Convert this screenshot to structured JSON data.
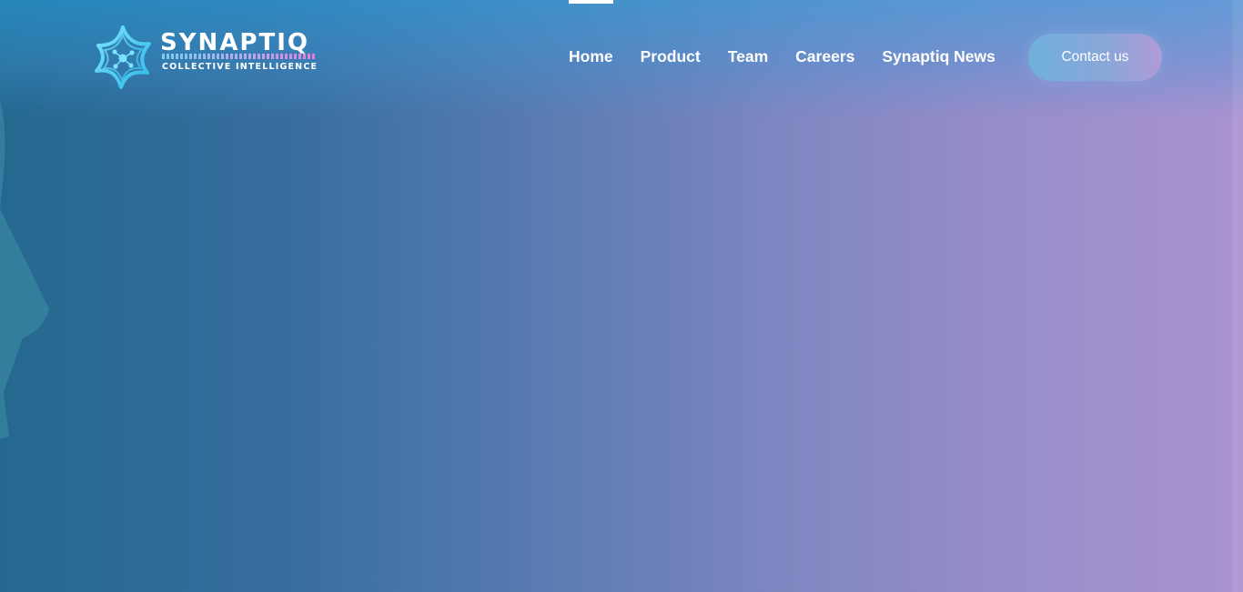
{
  "logo": {
    "title": "SYNAPTIQ",
    "tagline": "COLLECTIVE INTELLIGENCE",
    "icon": "synaptic-star-icon"
  },
  "nav": {
    "items": [
      {
        "label": "Home",
        "active": true
      },
      {
        "label": "Product",
        "active": false
      },
      {
        "label": "Team",
        "active": false
      },
      {
        "label": "Careers",
        "active": false
      },
      {
        "label": "Synaptiq News",
        "active": false
      }
    ],
    "contact_label": "Contact us"
  },
  "colors": {
    "gradient_left": "#24688f",
    "gradient_right": "#a992d1",
    "logo_cyan": "#5fd6f6",
    "logo_pink": "#f07bd8",
    "text": "#ffffff"
  }
}
